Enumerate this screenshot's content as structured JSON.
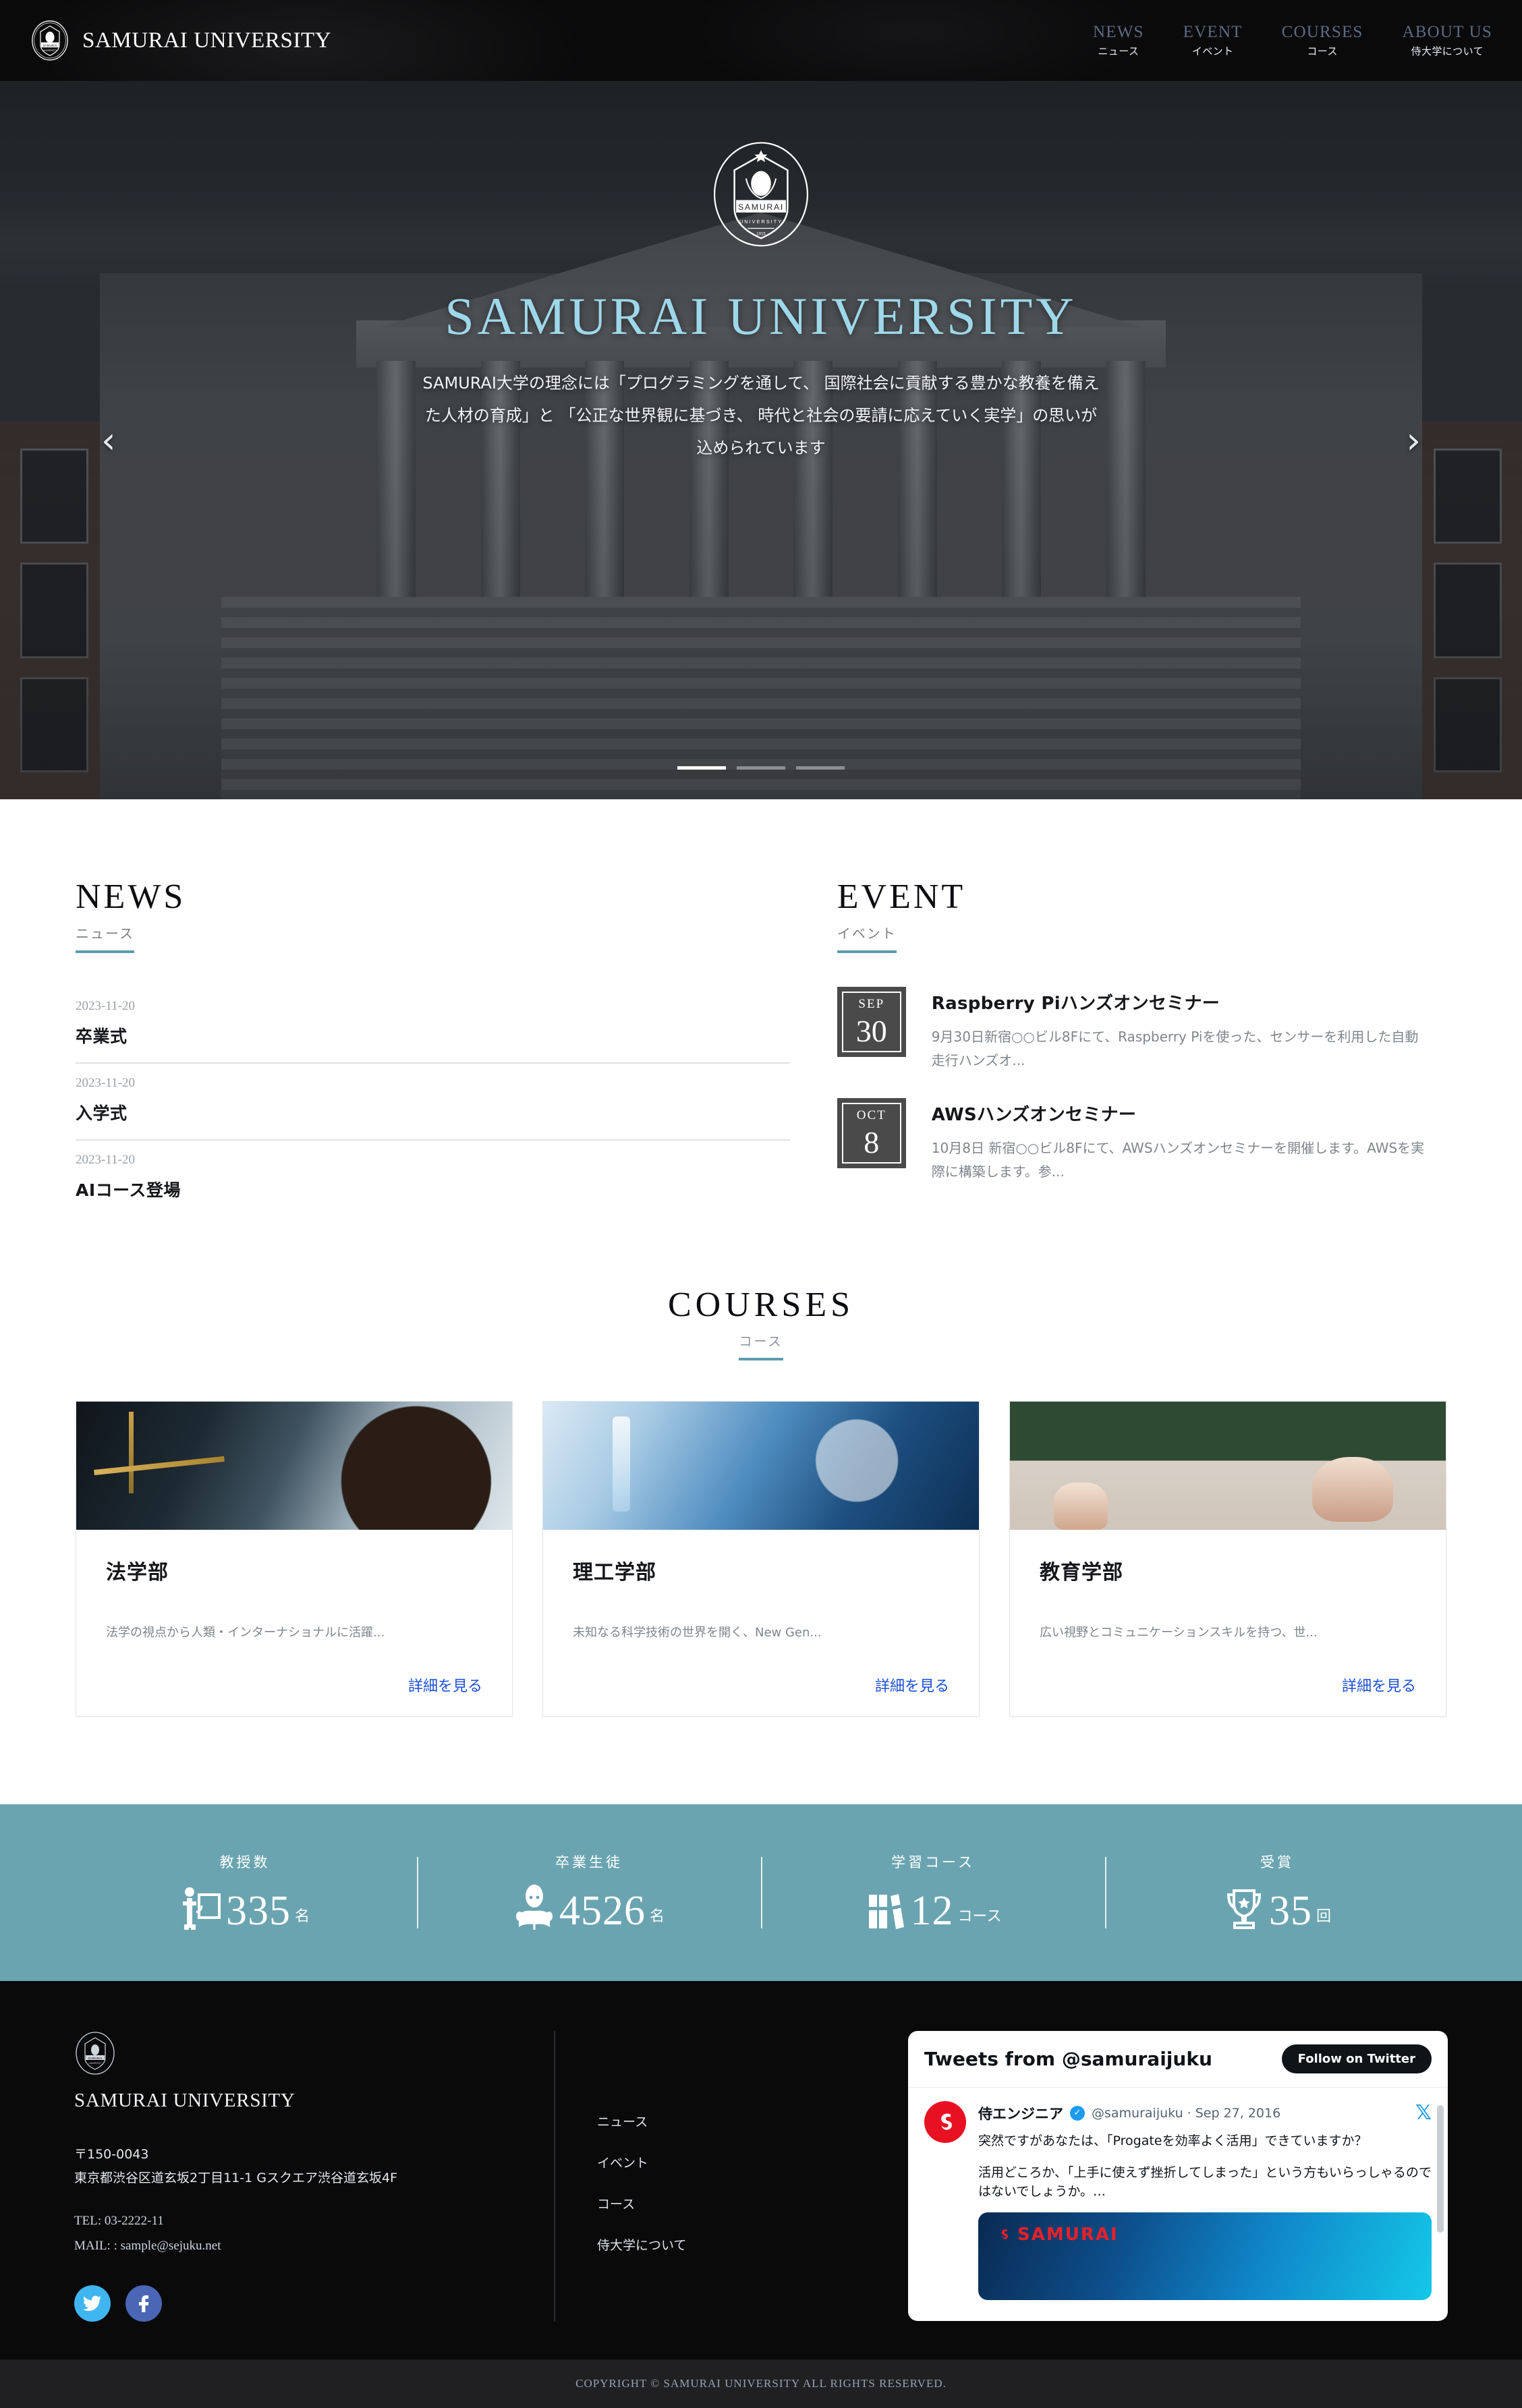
{
  "header": {
    "brand": "SAMURAI UNIVERSITY",
    "nav": [
      {
        "en": "NEWS",
        "jp": "ニュース"
      },
      {
        "en": "EVENT",
        "jp": "イベント"
      },
      {
        "en": "COURSES",
        "jp": "コース"
      },
      {
        "en": "ABOUT US",
        "jp": "侍大学について"
      }
    ]
  },
  "hero": {
    "crest_name": "SAMURAI",
    "crest_sub": "UNIVERSITY",
    "crest_year": "1915",
    "title": "SAMURAI UNIVERSITY",
    "description": "SAMURAI大学の理念には「プログラミングを通して、 国際社会に貢献する豊かな教養を備えた人材の育成」と 「公正な世界観に基づき、 時代と社会の要請に応えていく実学」の思いが込められています",
    "prev_label": "‹",
    "next_label": "›",
    "slides": [
      "1",
      "2",
      "3"
    ],
    "active_slide": 1
  },
  "news": {
    "heading_en": "NEWS",
    "heading_jp": "ニュース",
    "items": [
      {
        "date": "2023-11-20",
        "title": "卒業式"
      },
      {
        "date": "2023-11-20",
        "title": "入学式"
      },
      {
        "date": "2023-11-20",
        "title": "AIコース登場"
      }
    ]
  },
  "event": {
    "heading_en": "EVENT",
    "heading_jp": "イベント",
    "items": [
      {
        "month": "SEP",
        "day": "30",
        "title": "Raspberry Piハンズオンセミナー",
        "text": "9月30日新宿○○ビル8Fにて、Raspberry Piを使った、センサーを利用した自動走行ハンズオ..."
      },
      {
        "month": "OCT",
        "day": "8",
        "title": "AWSハンズオンセミナー",
        "text": "10月8日 新宿○○ビル8Fにて、AWSハンズオンセミナーを開催します。AWSを実際に構築します。参..."
      }
    ]
  },
  "courses": {
    "heading_en": "COURSES",
    "heading_jp": "コース",
    "more_label": "詳細を見る",
    "cards": [
      {
        "image": "law-gavel-scales-photo",
        "title": "法学部",
        "desc": "法学の視点から人類・インターナショナルに活躍..."
      },
      {
        "image": "science-lab-test-tube-photo",
        "title": "理工学部",
        "desc": "未知なる科学技術の世界を開く、New Gen..."
      },
      {
        "image": "education-classroom-teacher-photo",
        "title": "教育学部",
        "desc": "広い視野とコミュニケーションスキルを持つ、世..."
      }
    ]
  },
  "stats": [
    {
      "label": "教授数",
      "icon": "teacher-board-icon",
      "value": "335",
      "unit": "名"
    },
    {
      "label": "卒業生徒",
      "icon": "student-book-icon",
      "value": "4526",
      "unit": "名"
    },
    {
      "label": "学習コース",
      "icon": "books-icon",
      "value": "12",
      "unit": "コース"
    },
    {
      "label": "受賞",
      "icon": "trophy-icon",
      "value": "35",
      "unit": "回"
    }
  ],
  "footer": {
    "brand": "SAMURAI UNIVERSITY",
    "postal": "〒150-0043",
    "address": "東京都渋谷区道玄坂2丁目11-1 Gスクエア渋谷道玄坂4F",
    "tel": "TEL: 03-2222-11",
    "mail": "MAIL: : sample@sejuku.net",
    "nav": [
      "ニュース",
      "イベント",
      "コース",
      "侍大学について"
    ],
    "social": [
      "twitter-icon",
      "facebook-icon"
    ],
    "twitter": {
      "header": "Tweets from @samuraijuku",
      "follow_label": "Follow on Twitter",
      "account_name": "侍エンジニア",
      "handle": "@samuraijuku · Sep 27, 2016",
      "text_1": "突然ですがあなたは、「Progateを効率よく活用」できていますか？",
      "text_2": "活用どころか、「上手に使えず挫折してしまった」という方もいらっしゃるのではないでしょうか。…",
      "card_logo": "SAMURAI"
    },
    "copyright": "COPYRIGHT © SAMURAI UNIVERSITY ALL RIGHTS RESERVED."
  }
}
